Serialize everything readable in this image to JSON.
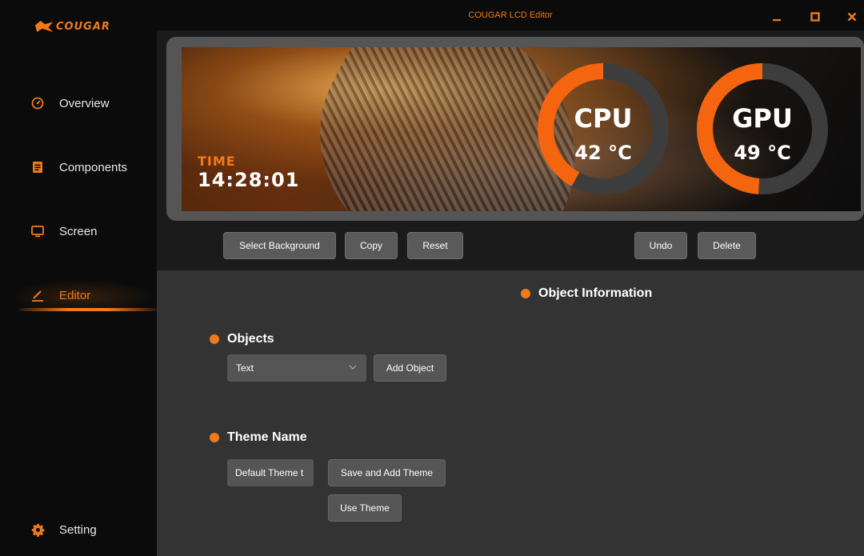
{
  "app": {
    "brand": "COUGAR",
    "window_title": "COUGAR LCD Editor",
    "accent_color": "#f27a1a"
  },
  "sidebar": {
    "items": [
      {
        "label": "Overview",
        "icon": "speedometer-icon"
      },
      {
        "label": "Components",
        "icon": "document-icon"
      },
      {
        "label": "Screen",
        "icon": "monitor-icon"
      },
      {
        "label": "Editor",
        "icon": "pen-icon",
        "active": true
      },
      {
        "label": "Setting",
        "icon": "gear-icon"
      }
    ]
  },
  "window_controls": {
    "minimize_icon": "minimize-icon",
    "maximize_icon": "maximize-icon",
    "close_icon": "close-icon"
  },
  "preview": {
    "time_label": "TIME",
    "time_value": "14:28:01",
    "gauges": [
      {
        "name": "CPU",
        "temp": "42 °C",
        "level": 0.42
      },
      {
        "name": "GPU",
        "temp": "49 °C",
        "level": 0.49
      }
    ]
  },
  "toolbar": {
    "select_background": "Select Background",
    "copy": "Copy",
    "reset": "Reset",
    "undo": "Undo",
    "delete": "Delete"
  },
  "object_info": {
    "heading": "Object Information"
  },
  "objects": {
    "heading": "Objects",
    "selected": "Text",
    "add_button": "Add Object"
  },
  "theme": {
    "heading": "Theme Name",
    "input_value": "Default Theme t",
    "save_button": "Save and Add Theme",
    "use_button": "Use Theme"
  }
}
